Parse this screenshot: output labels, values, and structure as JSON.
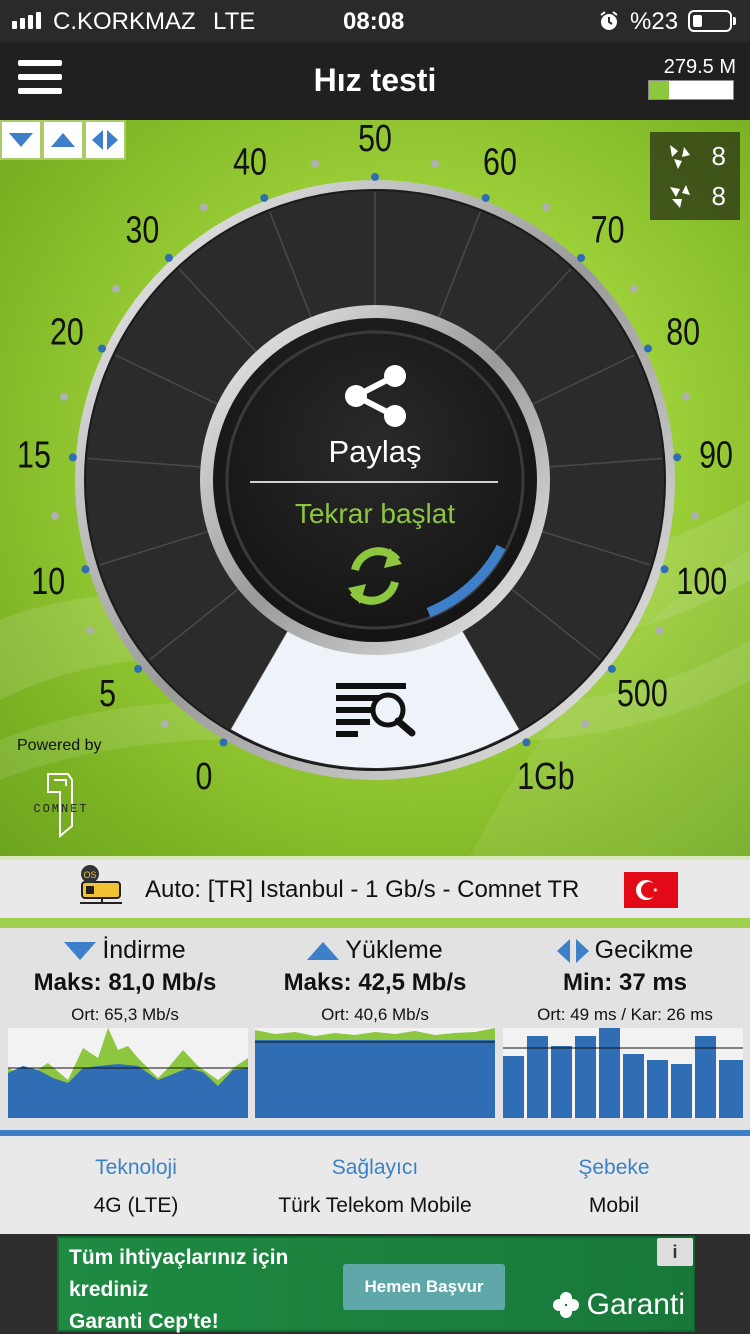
{
  "status": {
    "carrier": "C.KORKMAZ",
    "network": "LTE",
    "time": "08:08",
    "battery": "%23"
  },
  "header": {
    "title": "Hız testi",
    "data_usage": "279.5 M",
    "data_fraction": 0.24
  },
  "threads": {
    "download": "8",
    "upload": "8"
  },
  "gauge": {
    "scale": [
      "0",
      "5",
      "10",
      "15",
      "20",
      "30",
      "40",
      "50",
      "60",
      "70",
      "80",
      "90",
      "100",
      "500",
      "1Gb"
    ],
    "share_label": "Paylaş",
    "restart_label": "Tekrar başlat"
  },
  "powered_by": "Powered by",
  "comnet_logo": "COMNET",
  "server": {
    "label": "Auto: [TR] Istanbul - 1 Gb/s - Comnet TR",
    "flag": "turkey-flag"
  },
  "stats": {
    "download": {
      "title": "İndirme",
      "max": "Maks: 81,0 Mb/s",
      "avg": "Ort: 65,3 Mb/s"
    },
    "upload": {
      "title": "Yükleme",
      "max": "Maks: 42,5 Mb/s",
      "avg": "Ort: 40,6 Mb/s"
    },
    "latency": {
      "title": "Gecikme",
      "min": "Min: 37 ms",
      "avg": "Ort: 49 ms / Kar: 26 ms"
    }
  },
  "info": {
    "technology": {
      "label": "Teknoloji",
      "value": "4G (LTE)"
    },
    "provider": {
      "label": "Sağlayıcı",
      "value": "Türk Telekom Mobile"
    },
    "network": {
      "label": "Şebeke",
      "value": "Mobil"
    }
  },
  "ad": {
    "line1": "Tüm ihtiyaçlarınız için",
    "line2": "krediniz",
    "line3": "Garanti Cep'te!",
    "button": "Hemen Başvur",
    "brand": "Garanti",
    "info": "i"
  },
  "colors": {
    "accent_green": "#8dc63f",
    "accent_blue": "#3d7fc9",
    "dark": "#202020"
  }
}
